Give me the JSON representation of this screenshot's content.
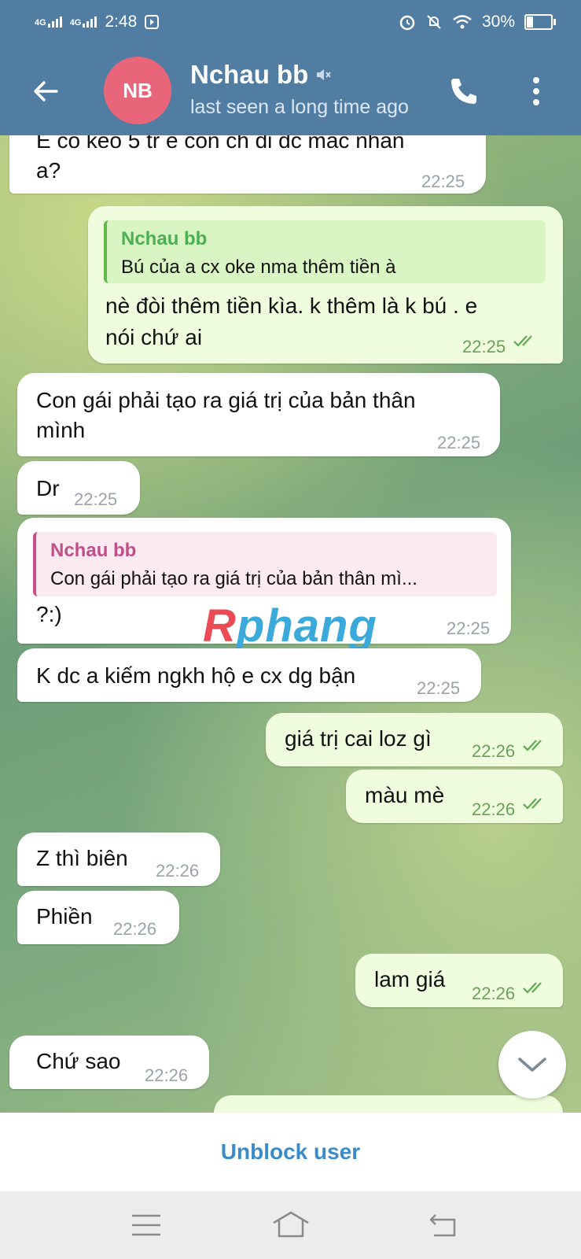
{
  "status_bar": {
    "network1": "4G",
    "network2": "4G",
    "time": "2:48",
    "battery_percent": "30%",
    "battery_level": 0.3,
    "icons": [
      "signal-icon",
      "signal-icon",
      "media-icon",
      "alarm-icon",
      "mute-icon",
      "wifi-icon",
      "battery-icon"
    ]
  },
  "header": {
    "avatar_initials": "NB",
    "avatar_color": "#e9667a",
    "name": "Nchau bb",
    "status": "last seen a long time ago",
    "icons": [
      "back-arrow-icon",
      "muted-icon",
      "phone-icon",
      "more-vertical-icon"
    ],
    "bar_color": "#517da2"
  },
  "messages": [
    {
      "dir": "in",
      "lines": [
        "E co keo 5 tr e con ch di dc mac nhan",
        "a?"
      ],
      "time": "22:25"
    },
    {
      "dir": "out",
      "reply_name": "Nchau bb",
      "reply_text": "Bú của a cx oke nma thêm tiền à",
      "lines": [
        "nè đòi thêm tiền kìa. k thêm là k bú . e",
        "nói chứ ai"
      ],
      "time": "22:25",
      "read": true
    },
    {
      "dir": "in",
      "lines": [
        "Con gái phải tạo ra giá trị của bản thân",
        "mình"
      ],
      "time": "22:25"
    },
    {
      "dir": "in",
      "lines": [
        "Dr"
      ],
      "time": "22:25"
    },
    {
      "dir": "in",
      "reply_name": "Nchau bb",
      "reply_text": "Con gái phải tạo ra giá trị của bản thân mì...",
      "lines": [
        "?:)"
      ],
      "time": "22:25"
    },
    {
      "dir": "in",
      "lines": [
        "K dc a kiếm ngkh hộ e cx dg bận"
      ],
      "time": "22:25"
    },
    {
      "dir": "out",
      "lines": [
        "giá trị cai loz gì"
      ],
      "time": "22:26",
      "read": true
    },
    {
      "dir": "out",
      "lines": [
        "màu mè"
      ],
      "time": "22:26",
      "read": true
    },
    {
      "dir": "in",
      "lines": [
        "Z thì biên"
      ],
      "time": "22:26"
    },
    {
      "dir": "in",
      "lines": [
        "Phiền"
      ],
      "time": "22:26"
    },
    {
      "dir": "out",
      "lines": [
        "lam giá"
      ],
      "time": "22:26",
      "read": true
    },
    {
      "dir": "in",
      "lines": [
        "Chứ sao"
      ],
      "time": "22:26"
    }
  ],
  "watermark": {
    "part1": "R",
    "part2": "phang"
  },
  "footer": {
    "unblock_label": "Unblock user"
  },
  "nav": {
    "icons": [
      "menu-icon",
      "home-icon",
      "back-icon"
    ]
  }
}
